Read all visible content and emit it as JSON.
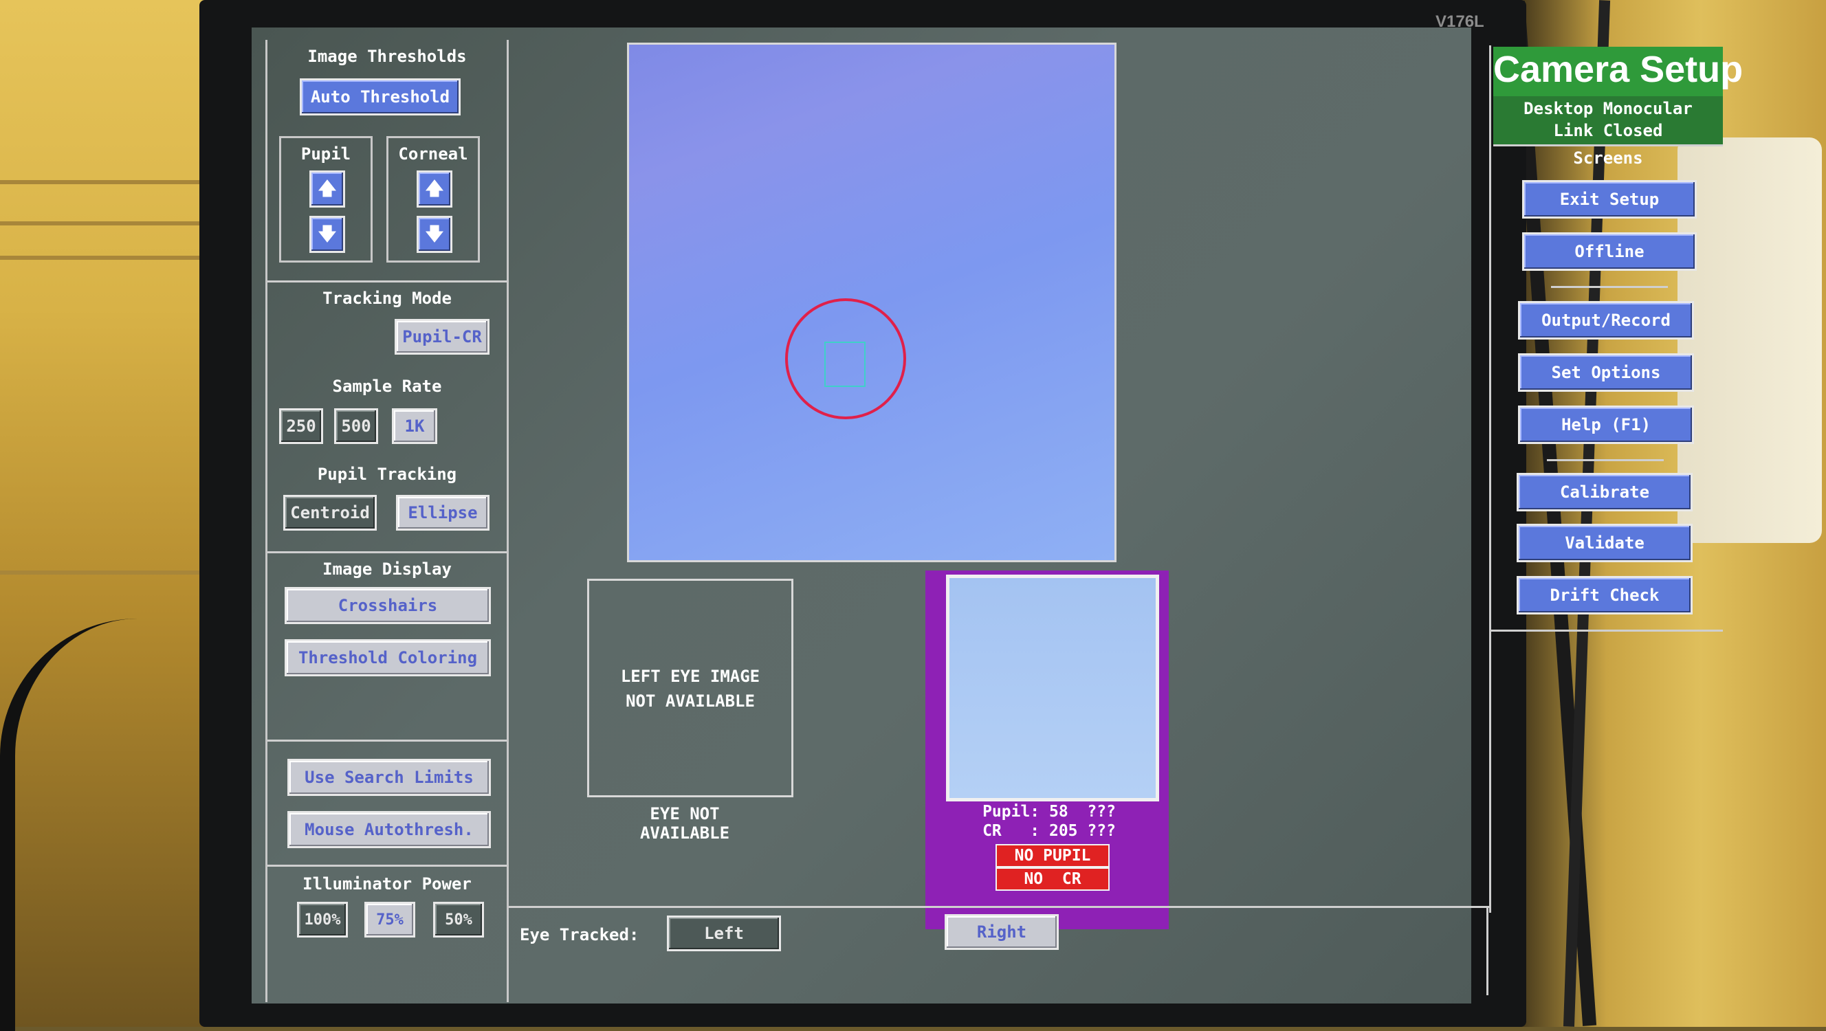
{
  "monitor": {
    "model_label": "V176L"
  },
  "left_panel": {
    "image_thresholds": {
      "heading": "Image Thresholds",
      "auto_button": "Auto Threshold"
    },
    "pupil": {
      "label": "Pupil",
      "up": "🡅",
      "down": "🡇"
    },
    "corneal": {
      "label": "Corneal",
      "up": "🡅",
      "down": "🡇"
    },
    "tracking_mode": {
      "heading": "Tracking Mode",
      "value": "Pupil-CR"
    },
    "sample_rate": {
      "heading": "Sample Rate",
      "options": [
        "250",
        "500",
        "1K"
      ],
      "selected": "1K"
    },
    "pupil_tracking": {
      "heading": "Pupil Tracking",
      "options": [
        "Centroid",
        "Ellipse"
      ],
      "selected": "Ellipse"
    },
    "image_display": {
      "heading": "Image Display",
      "crosshairs": "Crosshairs",
      "threshold_coloring": "Threshold Coloring"
    },
    "search": {
      "use_search_limits": "Use Search Limits",
      "mouse_autothresh": "Mouse Autothresh."
    },
    "illuminator_power": {
      "heading": "Illuminator Power",
      "options": [
        "100%",
        "75%",
        "50%"
      ],
      "selected": "75%"
    }
  },
  "center": {
    "left_eye": {
      "image_msg_line1": "LEFT EYE IMAGE",
      "image_msg_line2": "NOT AVAILABLE",
      "eye_msg_line1": "EYE NOT",
      "eye_msg_line2": "AVAILABLE"
    },
    "right_eye": {
      "pupil_line": "Pupil: 58  ???",
      "cr_line": "CR   : 205 ???",
      "no_pupil": "NO PUPIL",
      "no_cr": "NO  CR"
    },
    "eye_tracked": {
      "label": "Eye Tracked:",
      "left": "Left",
      "right": "Right"
    }
  },
  "right_panel": {
    "title": "Camera Setup",
    "mode_line1": "Desktop Monocular",
    "mode_line2": "Link Closed",
    "screens_heading": "Screens",
    "buttons": {
      "exit_setup": "Exit Setup",
      "offline": "Offline",
      "output_record": "Output/Record",
      "set_options": "Set Options",
      "help": "Help (F1)",
      "calibrate": "Calibrate",
      "validate": "Validate",
      "drift_check": "Drift Check"
    }
  },
  "colors": {
    "accent_blue": "#5a77d6",
    "title_green": "#2f9a3a",
    "panel_purple": "#8e21b5",
    "alert_red": "#e02222",
    "pupil_ring": "#e0204a",
    "cr_box": "#3fd0c8"
  }
}
